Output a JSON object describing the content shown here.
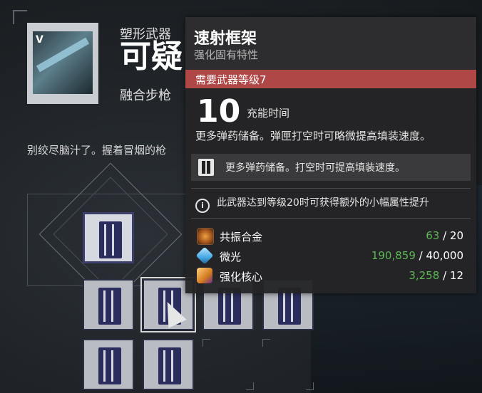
{
  "weapon": {
    "type": "塑形武器",
    "name": "可疑",
    "subtype": "融合步枪",
    "logo": "V",
    "flavor": "别绞尽脑汁了。握着冒烟的枪"
  },
  "perks": {
    "main": {
      "name": "magazine-perk",
      "icon": "magazine-icon"
    },
    "options_row1": [
      "magazine-icon",
      "magazine-icon",
      "magazine-icon",
      "magazine-icon"
    ],
    "options_row2": [
      "magazine-icon",
      "magazine-icon"
    ]
  },
  "tooltip": {
    "title": "速射框架",
    "subtitle": "强化固有特性",
    "requirement": "需要武器等级7",
    "stat_value": "10",
    "stat_label": "充能时间",
    "description": "更多弹药储备。弹匣打空时可略微提高填装速度。",
    "enhanced_description": "更多弹药储备。打空时可提高填装速度。",
    "info": "此武器达到等级20时可获得额外的小幅属性提升",
    "info_icon": "i",
    "materials": [
      {
        "name": "共振合金",
        "have": "63",
        "need": "20",
        "icon": "resonant-alloy-icon",
        "color": "#5db854"
      },
      {
        "name": "微光",
        "have": "190,859",
        "need": "40,000",
        "icon": "glimmer-icon",
        "color": "#5db854"
      },
      {
        "name": "强化核心",
        "have": "3,258",
        "need": "12",
        "icon": "enhancement-core-icon",
        "color": "#5db854"
      }
    ],
    "separator": "/"
  },
  "colors": {
    "requirement_bar": "#b04747",
    "have_amount": "#5db854",
    "tooltip_bg": "#242426"
  }
}
